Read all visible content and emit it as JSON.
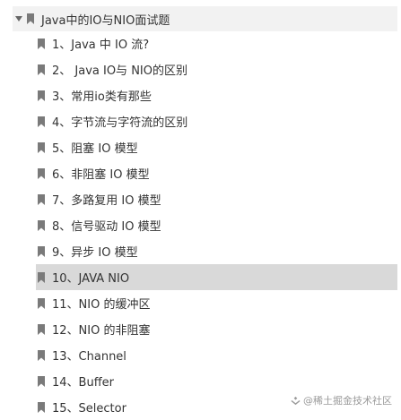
{
  "outline": {
    "root": {
      "label": "Java中的IO与NIO面试题",
      "icon": "bookmark-icon",
      "expander_icon": "caret-down-icon"
    },
    "items": [
      {
        "label": "1、Java 中 IO 流?",
        "selected": false
      },
      {
        "label": "2、 Java IO与 NIO的区别",
        "selected": false
      },
      {
        "label": "3、常用io类有那些",
        "selected": false
      },
      {
        "label": "4、字节流与字符流的区别",
        "selected": false
      },
      {
        "label": "5、阻塞 IO 模型",
        "selected": false
      },
      {
        "label": "6、非阻塞 IO 模型",
        "selected": false
      },
      {
        "label": "7、多路复用 IO 模型",
        "selected": false
      },
      {
        "label": "8、信号驱动 IO 模型",
        "selected": false
      },
      {
        "label": "9、异步 IO 模型",
        "selected": false
      },
      {
        "label": "10、JAVA NIO",
        "selected": true
      },
      {
        "label": "11、NIO 的缓冲区",
        "selected": false
      },
      {
        "label": "12、NIO 的非阻塞",
        "selected": false
      },
      {
        "label": "13、Channel",
        "selected": false
      },
      {
        "label": "14、Buffer",
        "selected": false
      },
      {
        "label": "15、Selector",
        "selected": false
      }
    ]
  },
  "watermark": {
    "text": "@稀土掘金技术社区",
    "icon": "juejin-logo-icon"
  },
  "colors": {
    "bookmark": "#7a7a7a",
    "text": "#333333",
    "root_highlight": "#f2f2f2",
    "selected_highlight": "#d9d9d9",
    "watermark": "#9a9a9a"
  }
}
